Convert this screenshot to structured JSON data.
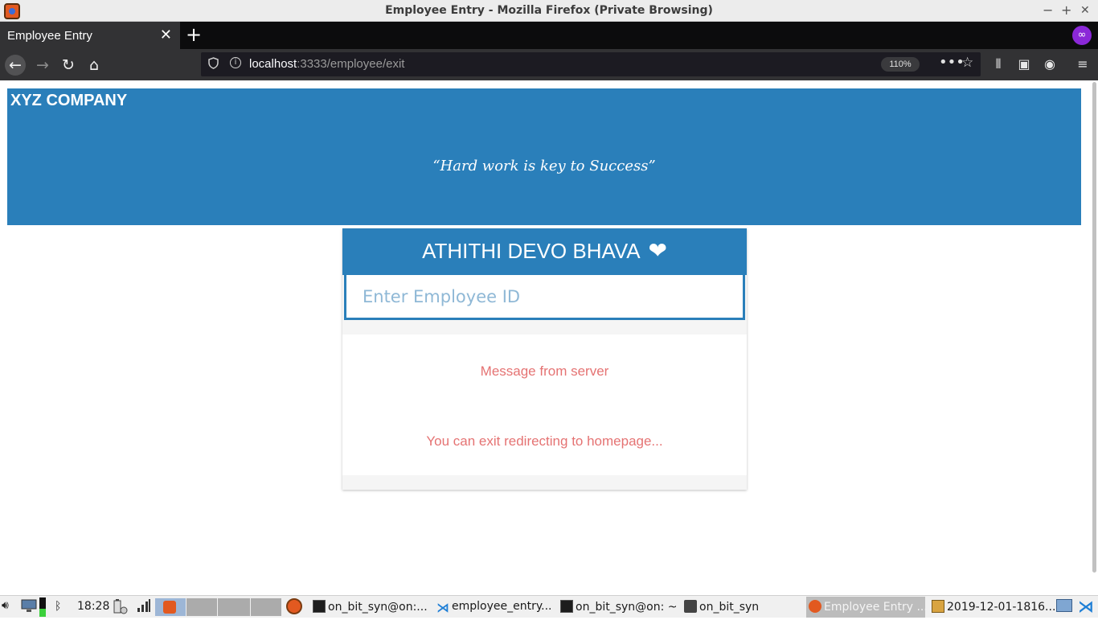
{
  "window": {
    "title": "Employee Entry - Mozilla Firefox (Private Browsing)",
    "minimize": "−",
    "maximize": "+",
    "close": "✕"
  },
  "tabs": [
    {
      "label": "Employee Entry",
      "close": "✕"
    }
  ],
  "newtab": "+",
  "private_icon": "∞",
  "nav": {
    "back": "←",
    "forward": "→",
    "reload": "↻",
    "home": "⌂"
  },
  "urlbar": {
    "host": "localhost",
    "rest": ":3333/employee/exit",
    "zoom": "110%",
    "more": "•••",
    "bookmark": "☆"
  },
  "toolbar_icons": [
    "library-icon",
    "sidebar-icon",
    "account-icon",
    "menu-icon"
  ],
  "toolbar_glyphs": {
    "library": "⫴",
    "sidebar": "▣",
    "account": "◉",
    "menu": "≡"
  },
  "page": {
    "company": "XYZ COMPANY",
    "quote": "“Hard work is key to Success”",
    "card_title": "ATHITHI DEVO BHAVA",
    "heart": "❤",
    "employee_id_placeholder": "Enter Employee ID",
    "employee_id_value": "",
    "message_title": "Message from server",
    "message_body": "You can exit redirecting to homepage..."
  },
  "colors": {
    "header_blue": "#2a7fba",
    "message_red": "#e57373",
    "placeholder_blue": "#8fb8d6"
  },
  "taskbar": {
    "time": "18:28",
    "windows": [
      {
        "label": "on_bit_syn@on:...",
        "icon": "terminal-icon"
      },
      {
        "label": "employee_entry...",
        "icon": "vscode-icon"
      },
      {
        "label": "on_bit_syn@on: ~",
        "icon": "terminal-icon"
      },
      {
        "label": "on_bit_syn",
        "icon": "folder-icon"
      },
      {
        "label": "Employee Entry ...",
        "icon": "firefox-icon"
      },
      {
        "label": "2019-12-01-1816...",
        "icon": "image-icon"
      }
    ]
  }
}
